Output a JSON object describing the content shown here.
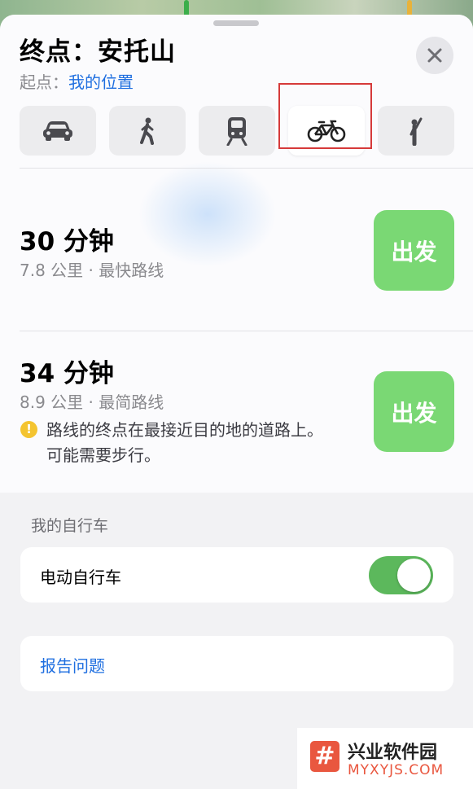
{
  "header": {
    "title": "终点：安托山",
    "origin_label": "起点：",
    "origin_value": "我的位置"
  },
  "transport_modes": [
    {
      "name": "car",
      "icon": "car-icon",
      "selected": false
    },
    {
      "name": "walk",
      "icon": "walking-person-icon",
      "selected": false
    },
    {
      "name": "transit",
      "icon": "train-icon",
      "selected": false
    },
    {
      "name": "bicycle",
      "icon": "bicycle-icon",
      "selected": true
    },
    {
      "name": "ride-hailing",
      "icon": "hailing-person-icon",
      "selected": false
    }
  ],
  "routes": [
    {
      "time": "30 分钟",
      "details": "7.8 公里 · 最快路线",
      "go_label": "出发"
    },
    {
      "time": "34 分钟",
      "details": "8.9 公里 · 最简路线",
      "warning": "路线的终点在最接近目的地的道路上。 可能需要步行。",
      "go_label": "出发"
    }
  ],
  "my_bike": {
    "section_title": "我的自行车",
    "ebike_label": "电动自行车",
    "ebike_enabled": true
  },
  "report": {
    "label": "报告问题"
  },
  "watermark": {
    "logo_glyph": "#",
    "name": "兴业软件园",
    "url": "MYXYJS.COM"
  },
  "colors": {
    "accent_blue": "#1f6fe0",
    "go_green": "#7ad874",
    "toggle_green": "#5cb85c",
    "highlight_red": "#d63a3a",
    "warning_yellow": "#f4c430"
  }
}
